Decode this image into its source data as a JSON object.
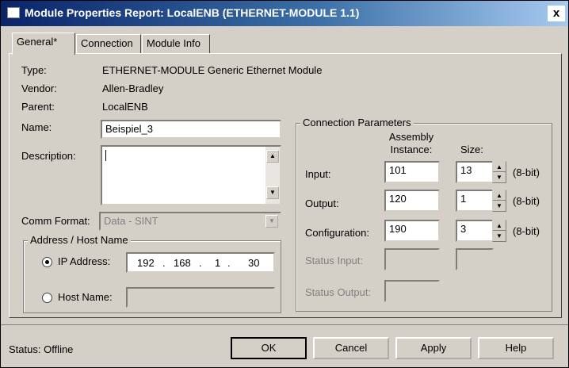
{
  "window": {
    "title": "Module Properties Report: LocalENB (ETHERNET-MODULE 1.1)",
    "close_glyph": "x"
  },
  "tabs": [
    {
      "label": "General*"
    },
    {
      "label": "Connection"
    },
    {
      "label": "Module Info"
    }
  ],
  "info": {
    "type_label": "Type:",
    "type_value": "ETHERNET-MODULE Generic Ethernet Module",
    "vendor_label": "Vendor:",
    "vendor_value": "Allen-Bradley",
    "parent_label": "Parent:",
    "parent_value": "LocalENB"
  },
  "name": {
    "label": "Name:",
    "value": "Beispiel_3"
  },
  "description": {
    "label": "Description:",
    "value": ""
  },
  "comm_format": {
    "label": "Comm Format:",
    "value": "Data - SINT"
  },
  "address": {
    "group_title": "Address / Host Name",
    "ip_label": "IP Address:",
    "ip": [
      "192",
      "168",
      "1",
      "30"
    ],
    "host_label": "Host Name:",
    "host_value": ""
  },
  "connection": {
    "group_title": "Connection Parameters",
    "assembly_header": "Assembly Instance:",
    "size_header": "Size:",
    "rows": [
      {
        "label": "Input:",
        "instance": "101",
        "size": "13",
        "unit": "(8-bit)"
      },
      {
        "label": "Output:",
        "instance": "120",
        "size": "1",
        "unit": "(8-bit)"
      },
      {
        "label": "Configuration:",
        "instance": "190",
        "size": "3",
        "unit": "(8-bit)"
      }
    ],
    "status_input_label": "Status Input:",
    "status_output_label": "Status Output:"
  },
  "footer": {
    "status": "Status:  Offline",
    "ok": "OK",
    "cancel": "Cancel",
    "apply": "Apply",
    "help": "Help"
  },
  "colors": {
    "title_bar": "#0a246a",
    "face": "#d4d0c8"
  }
}
